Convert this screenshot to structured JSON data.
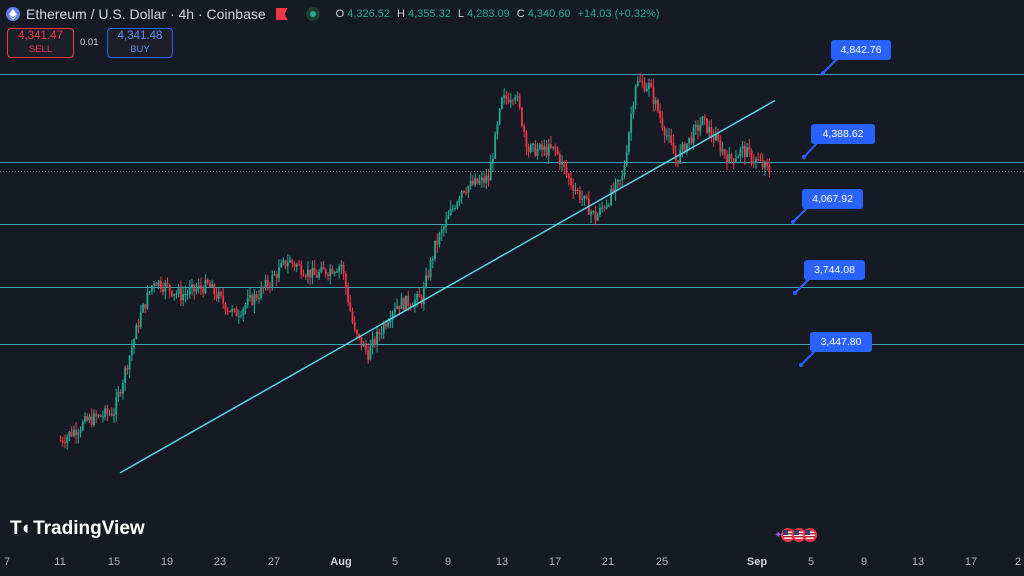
{
  "header": {
    "symbol_title": "Ethereum / U.S. Dollar · 4h · Coinbase",
    "ohlc": [
      {
        "key": "O",
        "value": "4,326.52"
      },
      {
        "key": "H",
        "value": "4,355.32"
      },
      {
        "key": "L",
        "value": "4,283.09"
      },
      {
        "key": "C",
        "value": "4,340.60"
      }
    ],
    "change": "+14.03 (+0.32%)"
  },
  "trade": {
    "sell_price": "4,341.47",
    "sell_label": "SELL",
    "spread": "0.01",
    "buy_price": "4,341.48",
    "buy_label": "BUY"
  },
  "levels": [
    {
      "label": "4,842.76",
      "price": 4842.76
    },
    {
      "label": "4,388.62",
      "price": 4388.62
    },
    {
      "label": "4,067.92",
      "price": 4067.92
    },
    {
      "label": "3,744.08",
      "price": 3744.08
    },
    {
      "label": "3,447.80",
      "price": 3447.8
    }
  ],
  "brand": "TradingView",
  "x_axis": {
    "labels": [
      "7",
      "11",
      "15",
      "19",
      "23",
      "27",
      "Aug",
      "5",
      "9",
      "13",
      "17",
      "21",
      "25",
      "Sep",
      "5",
      "9",
      "13",
      "17",
      "2"
    ],
    "bold": [
      "Aug",
      "Sep"
    ]
  },
  "colors": {
    "background": "#161a25",
    "up": "#22ab94",
    "down": "#f23645",
    "level_line": "#4dd0e1",
    "callout": "#2962ff"
  },
  "icons": {
    "symbol": "ethereum-coin-icon",
    "flag": "red-flag-icon",
    "market_status": "market-open-dot-icon",
    "events": "us-economic-events-icon"
  },
  "chart_data": {
    "type": "candlestick",
    "timeframe": "4h",
    "current_price": 4340.6,
    "horizontal_levels": [
      4842.76,
      4388.62,
      4067.92,
      3744.08,
      3447.8
    ],
    "trendline": {
      "from": {
        "date": "Jul 21",
        "price": 3000
      },
      "to": {
        "date": "Sep 1",
        "price": 4650
      }
    },
    "close_path": [
      {
        "date": "Jul 11",
        "price": 2950
      },
      {
        "date": "Jul 13",
        "price": 3050
      },
      {
        "date": "Jul 15",
        "price": 3100
      },
      {
        "date": "Jul 17",
        "price": 3600
      },
      {
        "date": "Jul 18",
        "price": 3780
      },
      {
        "date": "Jul 20",
        "price": 3700
      },
      {
        "date": "Jul 22",
        "price": 3750
      },
      {
        "date": "Jul 24",
        "price": 3600
      },
      {
        "date": "Jul 26",
        "price": 3720
      },
      {
        "date": "Jul 28",
        "price": 3880
      },
      {
        "date": "Jul 30",
        "price": 3800
      },
      {
        "date": "Aug 1",
        "price": 3860
      },
      {
        "date": "Aug 2",
        "price": 3500
      },
      {
        "date": "Aug 3",
        "price": 3400
      },
      {
        "date": "Aug 5",
        "price": 3650
      },
      {
        "date": "Aug 7",
        "price": 3680
      },
      {
        "date": "Aug 8",
        "price": 3950
      },
      {
        "date": "Aug 10",
        "price": 4250
      },
      {
        "date": "Aug 12",
        "price": 4300
      },
      {
        "date": "Aug 13",
        "price": 4700
      },
      {
        "date": "Aug 14",
        "price": 4750
      },
      {
        "date": "Aug 15",
        "price": 4450
      },
      {
        "date": "Aug 17",
        "price": 4450
      },
      {
        "date": "Aug 18",
        "price": 4300
      },
      {
        "date": "Aug 19",
        "price": 4200
      },
      {
        "date": "Aug 20",
        "price": 4100
      },
      {
        "date": "Aug 22",
        "price": 4300
      },
      {
        "date": "Aug 23",
        "price": 4800
      },
      {
        "date": "Aug 24",
        "price": 4780
      },
      {
        "date": "Aug 26",
        "price": 4400
      },
      {
        "date": "Aug 28",
        "price": 4600
      },
      {
        "date": "Aug 30",
        "price": 4400
      },
      {
        "date": "Aug 31",
        "price": 4450
      },
      {
        "date": "Sep 2",
        "price": 4341
      }
    ]
  }
}
